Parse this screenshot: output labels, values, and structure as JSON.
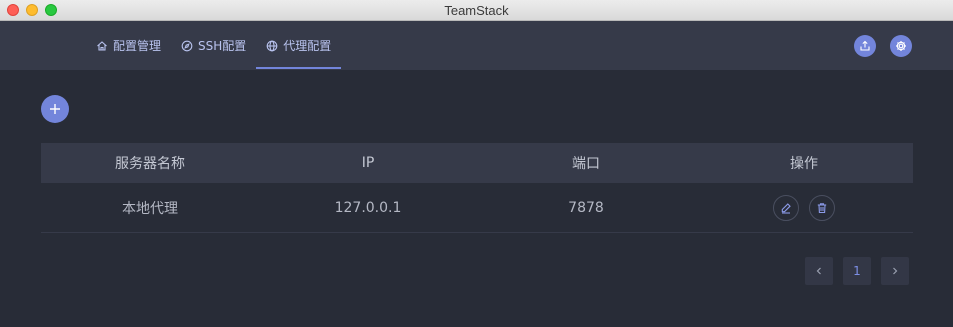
{
  "window": {
    "title": "TeamStack"
  },
  "nav": {
    "tabs": [
      {
        "label": "配置管理",
        "icon": "home-icon"
      },
      {
        "label": "SSH配置",
        "icon": "compass-icon"
      },
      {
        "label": "代理配置",
        "icon": "globe-icon",
        "active": true
      }
    ],
    "actions": [
      {
        "icon": "upload-icon"
      },
      {
        "icon": "gear-icon"
      }
    ]
  },
  "toolbar": {
    "add_icon": "plus-icon"
  },
  "table": {
    "columns": [
      "服务器名称",
      "IP",
      "端口",
      "操作"
    ],
    "rows": [
      {
        "name": "本地代理",
        "ip": "127.0.0.1",
        "port": "7878"
      }
    ],
    "row_actions": [
      {
        "icon": "edit-icon"
      },
      {
        "icon": "trash-icon"
      }
    ]
  },
  "pagination": {
    "prev_icon": "chevron-left-icon",
    "current_page": "1",
    "next_icon": "chevron-right-icon"
  },
  "colors": {
    "accent": "#7385db",
    "background": "#282c37",
    "panel": "#363a49"
  }
}
